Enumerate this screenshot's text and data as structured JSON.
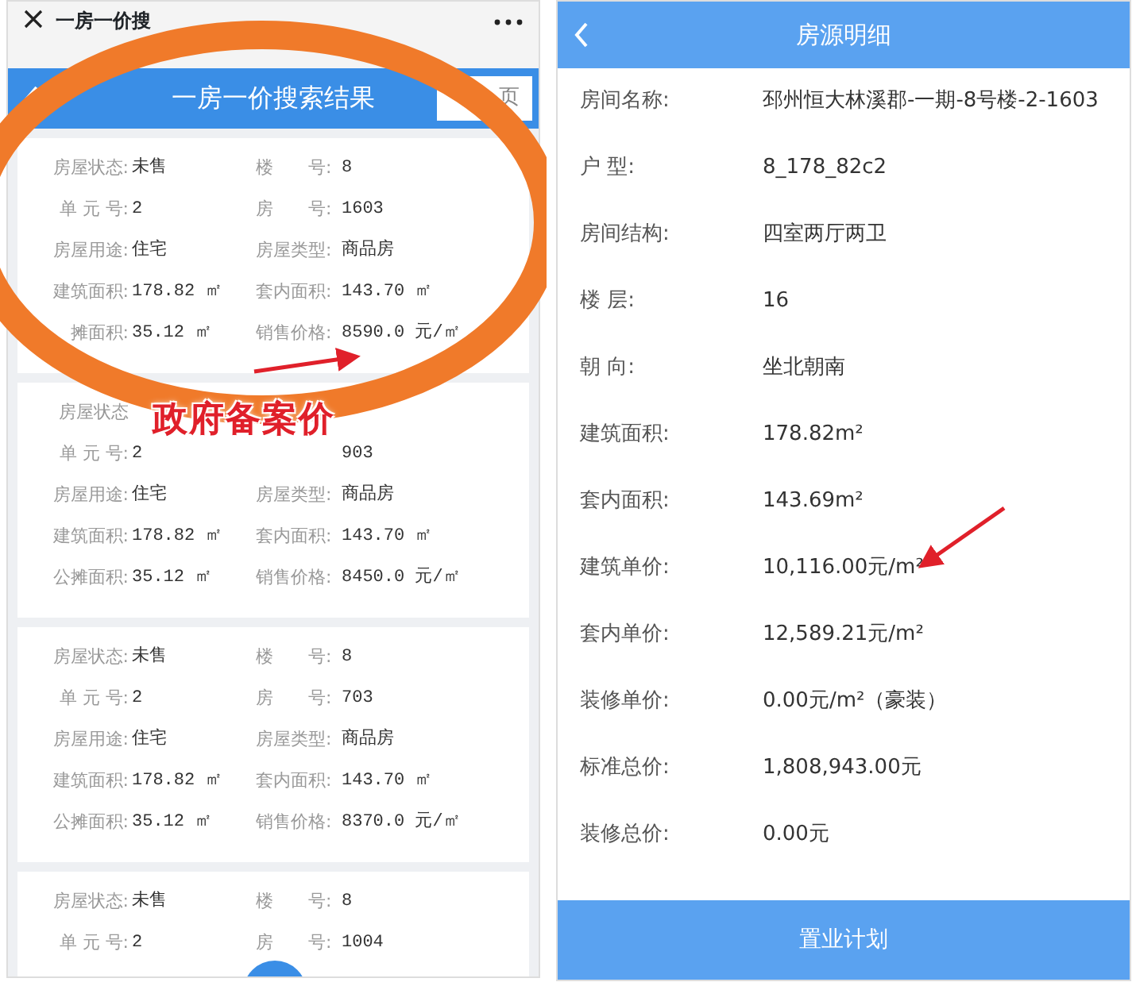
{
  "search_screen": {
    "window_title": "一房一价搜",
    "header_title": "一房一价搜索结果",
    "home_button": "页",
    "cards": [
      {
        "rows": [
          {
            "cells": [
              {
                "label": "房屋状态:",
                "value": "未售"
              },
              {
                "label": "楼　　号:",
                "value": "8"
              }
            ]
          },
          {
            "cells": [
              {
                "label": "单 元 号:",
                "value": "2"
              },
              {
                "label": "房　　号:",
                "value": "1603"
              }
            ]
          },
          {
            "cells": [
              {
                "label": "房屋用途:",
                "value": "住宅"
              },
              {
                "label": "房屋类型:",
                "value": "商品房"
              }
            ]
          },
          {
            "cells": [
              {
                "label": "建筑面积:",
                "value": "178.82 ㎡"
              },
              {
                "label": "套内面积:",
                "value": "143.70 ㎡"
              }
            ]
          },
          {
            "cells": [
              {
                "label": "摊面积:",
                "value": "35.12 ㎡"
              },
              {
                "label": "销售价格:",
                "value": "8590.0 元/㎡"
              }
            ]
          }
        ]
      },
      {
        "rows": [
          {
            "cells": [
              {
                "label": "房屋状态"
              },
              {}
            ]
          },
          {
            "cells": [
              {
                "label": "单 元 号:",
                "value": "2"
              },
              {
                "value": "903"
              }
            ]
          },
          {
            "cells": [
              {
                "label": "房屋用途:",
                "value": "住宅"
              },
              {
                "label": "房屋类型:",
                "value": "商品房"
              }
            ]
          },
          {
            "cells": [
              {
                "label": "建筑面积:",
                "value": "178.82 ㎡"
              },
              {
                "label": "套内面积:",
                "value": "143.70 ㎡"
              }
            ]
          },
          {
            "cells": [
              {
                "label": "公摊面积:",
                "value": "35.12 ㎡"
              },
              {
                "label": "销售价格:",
                "value": "8450.0 元/㎡"
              }
            ]
          }
        ]
      },
      {
        "rows": [
          {
            "cells": [
              {
                "label": "房屋状态:",
                "value": "未售"
              },
              {
                "label": "楼　　号:",
                "value": "8"
              }
            ]
          },
          {
            "cells": [
              {
                "label": "单 元 号:",
                "value": "2"
              },
              {
                "label": "房　　号:",
                "value": "703"
              }
            ]
          },
          {
            "cells": [
              {
                "label": "房屋用途:",
                "value": "住宅"
              },
              {
                "label": "房屋类型:",
                "value": "商品房"
              }
            ]
          },
          {
            "cells": [
              {
                "label": "建筑面积:",
                "value": "178.82 ㎡"
              },
              {
                "label": "套内面积:",
                "value": "143.70 ㎡"
              }
            ]
          },
          {
            "cells": [
              {
                "label": "公摊面积:",
                "value": "35.12 ㎡"
              },
              {
                "label": "销售价格:",
                "value": "8370.0 元/㎡"
              }
            ]
          }
        ]
      },
      {
        "rows": [
          {
            "cells": [
              {
                "label": "房屋状态:",
                "value": "未售"
              },
              {
                "label": "楼　　号:",
                "value": "8"
              }
            ]
          },
          {
            "cells": [
              {
                "label": "单 元 号:",
                "value": "2"
              },
              {
                "label": "房　　号:",
                "value": "1004"
              }
            ]
          }
        ]
      }
    ]
  },
  "detail_screen": {
    "header_title": "房源明细",
    "fields": [
      {
        "label": "房间名称:",
        "value": "邳州恒大林溪郡-一期-8号楼-2-1603"
      },
      {
        "label": "户 型:",
        "value": "8_178_82c2"
      },
      {
        "label": "房间结构:",
        "value": "四室两厅两卫"
      },
      {
        "label": "楼 层:",
        "value": "16"
      },
      {
        "label": "朝 向:",
        "value": "坐北朝南"
      },
      {
        "label": "建筑面积:",
        "value": "178.82m²"
      },
      {
        "label": "套内面积:",
        "value": "143.69m²"
      },
      {
        "label": "建筑单价:",
        "value": "10,116.00元/m²"
      },
      {
        "label": "套内单价:",
        "value": "12,589.21元/m²"
      },
      {
        "label": "装修单价:",
        "value": "0.00元/m²（豪装）"
      },
      {
        "label": "标准总价:",
        "value": "1,808,943.00元"
      },
      {
        "label": "装修总价:",
        "value": "0.00元"
      }
    ],
    "bottom_button": "置业计划"
  },
  "annotation": {
    "caption": "政府备案价"
  }
}
